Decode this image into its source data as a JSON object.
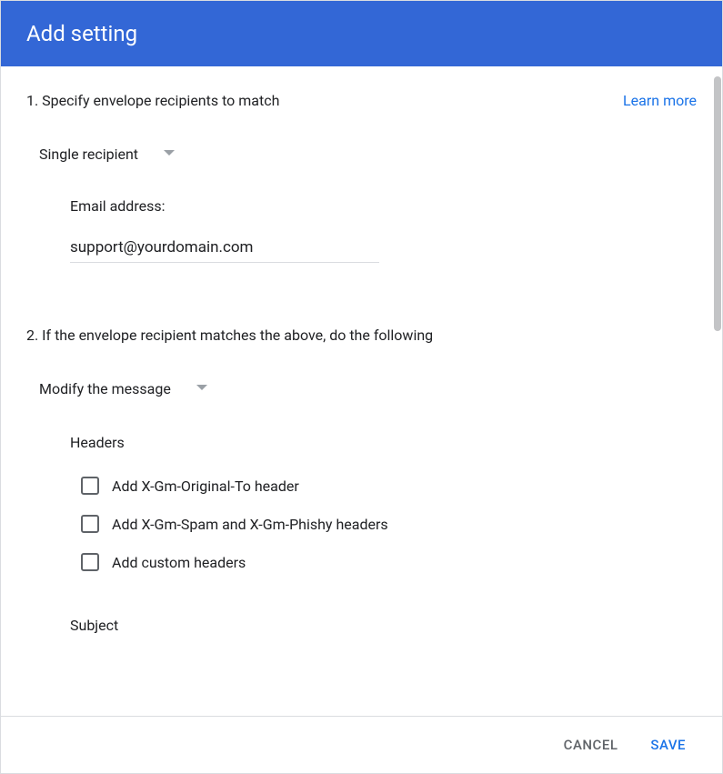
{
  "header": {
    "title": "Add setting"
  },
  "section1": {
    "title": "1. Specify envelope recipients to match",
    "learn_more": "Learn more",
    "dropdown_label": "Single recipient",
    "email_label": "Email address:",
    "email_value": "support@yourdomain.com"
  },
  "section2": {
    "title": "2. If the envelope recipient matches the above, do the following",
    "dropdown_label": "Modify the message",
    "headers_title": "Headers",
    "checkboxes": [
      {
        "label": "Add X-Gm-Original-To header"
      },
      {
        "label": "Add X-Gm-Spam and X-Gm-Phishy headers"
      },
      {
        "label": "Add custom headers"
      }
    ],
    "subject_title": "Subject"
  },
  "footer": {
    "cancel": "CANCEL",
    "save": "SAVE"
  }
}
